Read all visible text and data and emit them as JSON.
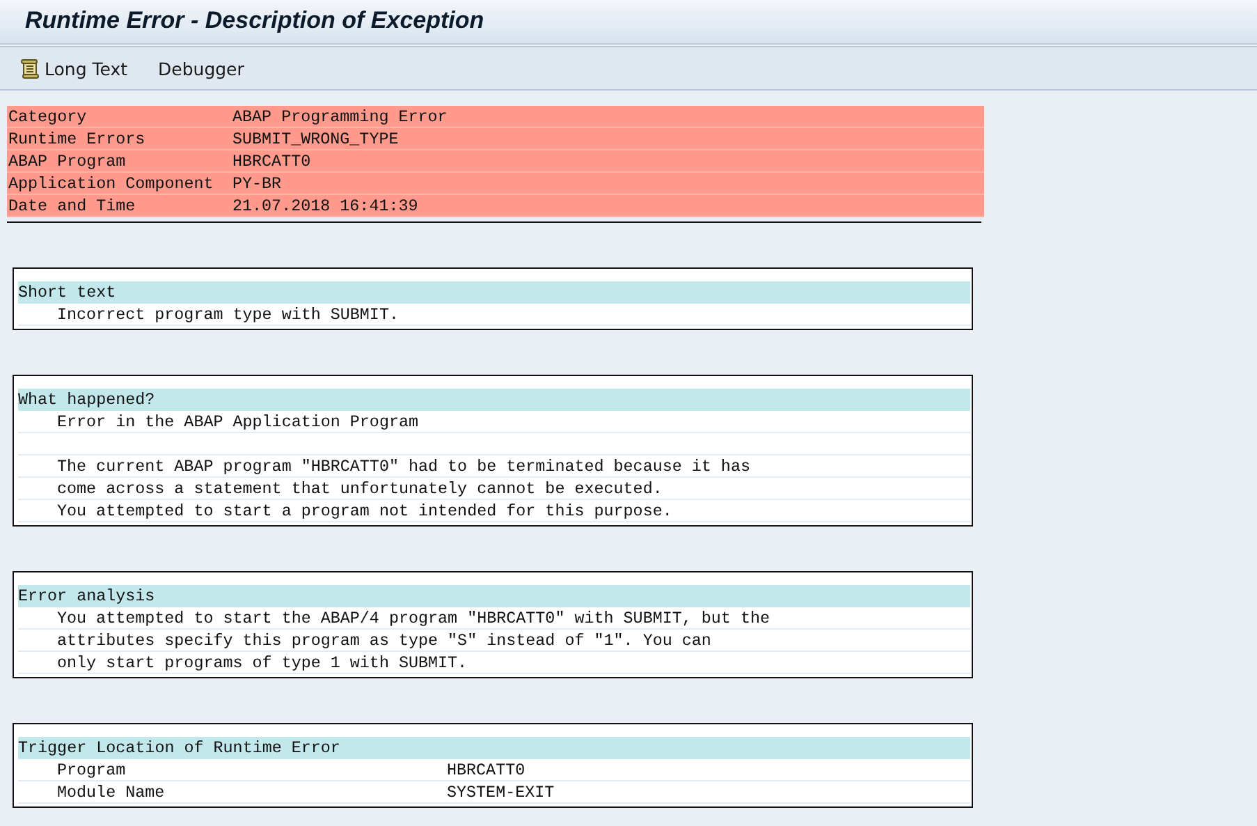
{
  "window": {
    "title": "Runtime Error - Description of Exception"
  },
  "toolbar": [
    {
      "kind": "icon",
      "label": "Long Text"
    },
    {
      "kind": "plain",
      "label": "Debugger"
    }
  ],
  "header_rows": [
    {
      "label": "Category",
      "value": "ABAP Programming Error"
    },
    {
      "label": "Runtime Errors",
      "value": "SUBMIT_WRONG_TYPE"
    },
    {
      "label": "ABAP Program",
      "value": "HBRCATT0"
    },
    {
      "label": "Application Component",
      "value": "PY-BR"
    },
    {
      "label": "Date and Time",
      "value": "21.07.2018 16:41:39"
    }
  ],
  "sections": [
    {
      "heading": "Short text",
      "lines": [
        {
          "kind": "text",
          "text": "Incorrect program type with SUBMIT."
        }
      ]
    },
    {
      "heading": "What happened?",
      "lines": [
        {
          "kind": "text",
          "text": "Error in the ABAP Application Program"
        },
        {
          "kind": "blank"
        },
        {
          "kind": "text",
          "text": "The current ABAP program \"HBRCATT0\" had to be terminated because it has"
        },
        {
          "kind": "text",
          "text": "come across a statement that unfortunately cannot be executed."
        },
        {
          "kind": "text",
          "text": "You attempted to start a program not intended for this purpose."
        }
      ]
    },
    {
      "heading": "Error analysis",
      "lines": [
        {
          "kind": "text",
          "text": "You attempted to start the ABAP/4 program \"HBRCATT0\" with SUBMIT, but the"
        },
        {
          "kind": "text",
          "text": "attributes specify this program as type \"S\" instead of \"1\". You can"
        },
        {
          "kind": "text",
          "text": "only start programs of type 1 with SUBMIT."
        }
      ]
    },
    {
      "heading": "Trigger Location of Runtime Error",
      "lines": [
        {
          "kind": "pair",
          "label": "Program",
          "value": "HBRCATT0"
        },
        {
          "kind": "pair",
          "label": "Module Name",
          "value": "SYSTEM-EXIT"
        }
      ]
    }
  ]
}
